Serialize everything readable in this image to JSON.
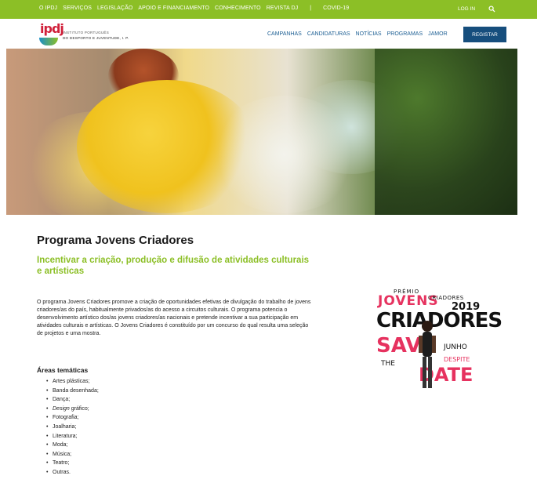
{
  "topbar": {
    "items": [
      "O IPDJ",
      "SERVIÇOS",
      "LEGISLAÇÃO",
      "APOIO E FINANCIAMENTO",
      "CONHECIMENTO",
      "REVISTA DJ"
    ],
    "separator": "|",
    "covid": "COVID-19",
    "login": "LOG IN",
    "search_icon": "search-icon",
    "color": "#8cbf26"
  },
  "header": {
    "logo_mark": "ipdj",
    "logo_line1": "INSTITUTO PORTUGUÊS",
    "logo_line2": "DO DESPORTO E JUVENTUDE, I. P.",
    "nav": [
      "CAMPANHAS",
      "CANDIDATURAS",
      "NOTÍCIAS",
      "PROGRAMAS",
      "JAMOR"
    ],
    "register": "REGISTAR",
    "register_color": "#164e7d"
  },
  "main": {
    "title": "Programa Jovens Criadores",
    "subtitle": "Incentivar a criação, produção e difusão de atividades culturais e artísticas",
    "intro": "O programa Jovens Criadores promove a criação de oportunidades efetivas de divulgação do trabalho de jovens criadores/as do país, habitualmente privados/as do acesso a circuitos culturais. O programa potencia o desenvolvimento artístico dos/as jovens criadores/as nacionais e pretende incentivar a sua participação em atividades culturais e artísticas. O Jovens Criadores é constituído por um concurso do qual resulta uma seleção de projetos e uma mostra.",
    "areas_title": "Áreas temáticas",
    "areas": [
      "Artes plásticas;",
      "Banda desenhada;",
      "Dança;",
      "Fotografia;",
      "Joalharia;",
      "Literatura;",
      "Moda;",
      "Música;",
      "Teatro;",
      "Outras."
    ],
    "design_item": {
      "italic": "Design",
      "rest": " gráfico;"
    }
  },
  "poster": {
    "premio": "PRÉMIO",
    "jovens": "JOVENS",
    "criadores_small": "CRIADORES",
    "year": "2019",
    "criadores_big": "CRIADORES",
    "save": "SAVE",
    "junho": "JUNHO",
    "the": "THE",
    "despite": "DESPITE",
    "date": "DATE"
  }
}
